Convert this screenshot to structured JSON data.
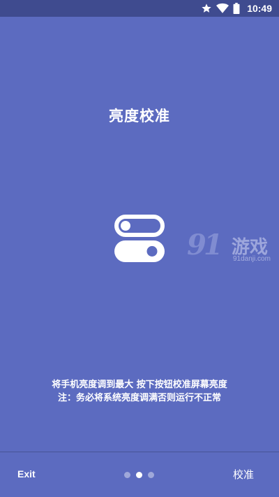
{
  "status_bar": {
    "time": "10:49",
    "icons": [
      "star-icon",
      "wifi-icon",
      "battery-icon"
    ]
  },
  "title": "亮度校准",
  "center_icon": "toggle-switches-icon",
  "watermark": {
    "number": "91",
    "text": "游戏",
    "url": "91danji.com"
  },
  "instructions": {
    "line1": "将手机亮度调到最大 按下按钮校准屏幕亮度",
    "line2": "注：务必将系统亮度调满否则运行不正常"
  },
  "bottom_bar": {
    "exit_label": "Exit",
    "calibrate_label": "校准",
    "page_count": 3,
    "current_page": 2
  },
  "colors": {
    "background": "#5c6bc0",
    "status_bar": "#3f4b8f",
    "dot_inactive": "#9fa8da",
    "dot_active": "#ffffff"
  }
}
